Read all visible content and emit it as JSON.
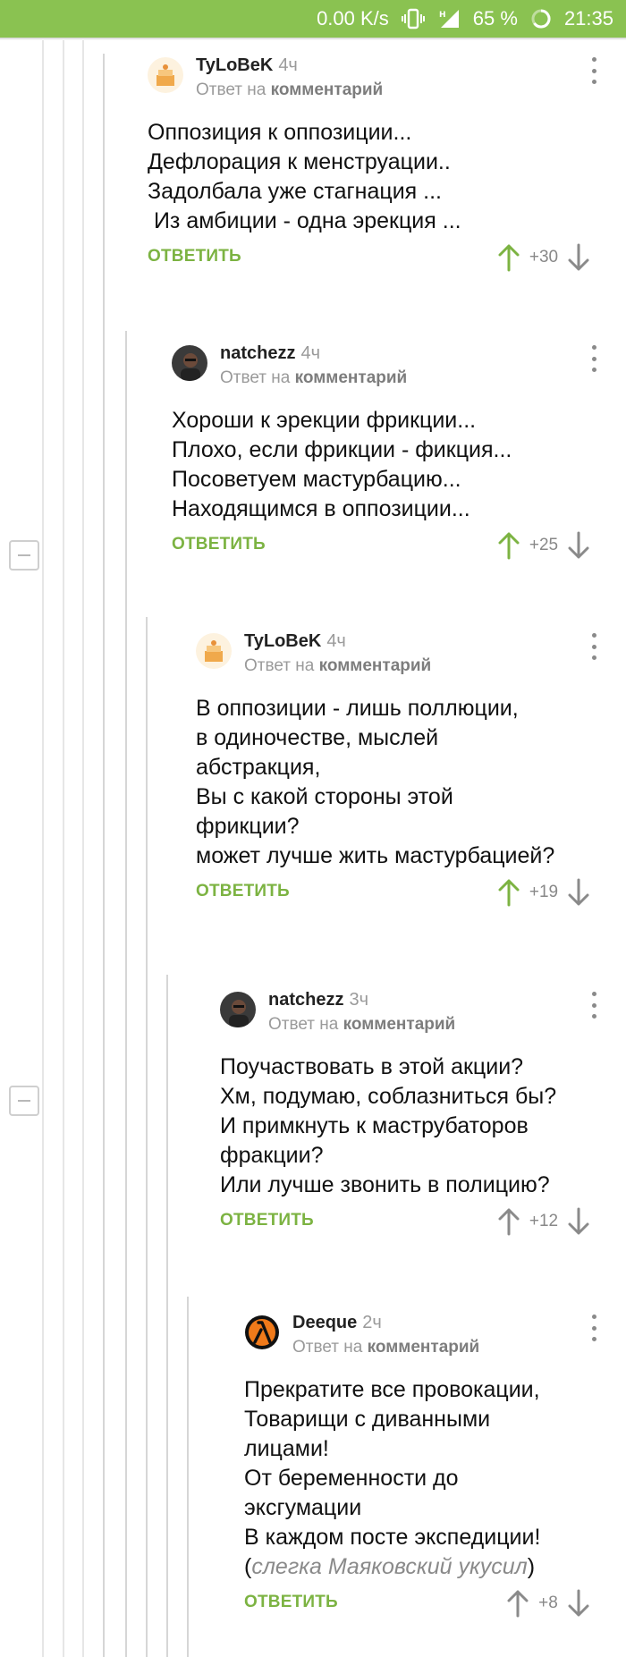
{
  "status_bar": {
    "speed": "0.00 K/s",
    "battery": "65 %",
    "time": "21:35",
    "icons": [
      "vibrate-icon",
      "signal-h-icon",
      "battery-ring-icon"
    ]
  },
  "colors": {
    "accent": "#8ac251",
    "reply": "#7cb342",
    "upvote": "#7cb342",
    "muted": "#9a9a9a"
  },
  "comments": [
    {
      "author": "TyLoBeK",
      "time": "4ч",
      "reply_prefix": "Ответ на",
      "reply_target": "комментарий",
      "text": "Оппозиция к оппозиции...\nДефлорация к менструации..\nЗадолбала уже стагнация ...\n Из амбиции - одна эрекция ...",
      "reply_label": "ОТВЕТИТЬ",
      "score": "+30",
      "upvoted": true,
      "avatar": "cake-avatar"
    },
    {
      "author": "natchezz",
      "time": "4ч",
      "reply_prefix": "Ответ на",
      "reply_target": "комментарий",
      "text": "Хороши к эрекции фрикции...\nПлохо, если фрикции - фикция...\nПосоветуем мастурбацию...\nНаходящимся в оппозиции...",
      "reply_label": "ОТВЕТИТЬ",
      "score": "+25",
      "upvoted": true,
      "avatar": "photo-avatar"
    },
    {
      "author": "TyLoBeK",
      "time": "4ч",
      "reply_prefix": "Ответ на",
      "reply_target": "комментарий",
      "text": "В оппозиции - лишь поллюции,\nв одиночестве, мыслей\nабстракция,\nВы с какой стороны этой\nфрикции?\nможет лучше жить мастурбацией?",
      "reply_label": "ОТВЕТИТЬ",
      "score": "+19",
      "upvoted": true,
      "avatar": "cake-avatar"
    },
    {
      "author": "natchezz",
      "time": "3ч",
      "reply_prefix": "Ответ на",
      "reply_target": "комментарий",
      "text": "Поучаствовать в этой акции?\nХм, подумаю, соблазниться бы?\nИ примкнуть к маструбаторов\nфракции?\nИли лучше звонить в полицию?",
      "reply_label": "ОТВЕТИТЬ",
      "score": "+12",
      "upvoted": false,
      "avatar": "photo-avatar"
    },
    {
      "author": "Deeque",
      "time": "2ч",
      "reply_prefix": "Ответ на",
      "reply_target": "комментарий",
      "text": "Прекратите все провокации,\nТоварищи с диванными\nлицами!\nОт беременности до\nэксгумации\nВ каждом посте экспедиции!\n(",
      "quote": "слегка Маяковский укусил",
      "text_end": ")",
      "reply_label": "ОТВЕТИТЬ",
      "score": "+8",
      "upvoted": false,
      "avatar": "lambda-avatar"
    }
  ]
}
